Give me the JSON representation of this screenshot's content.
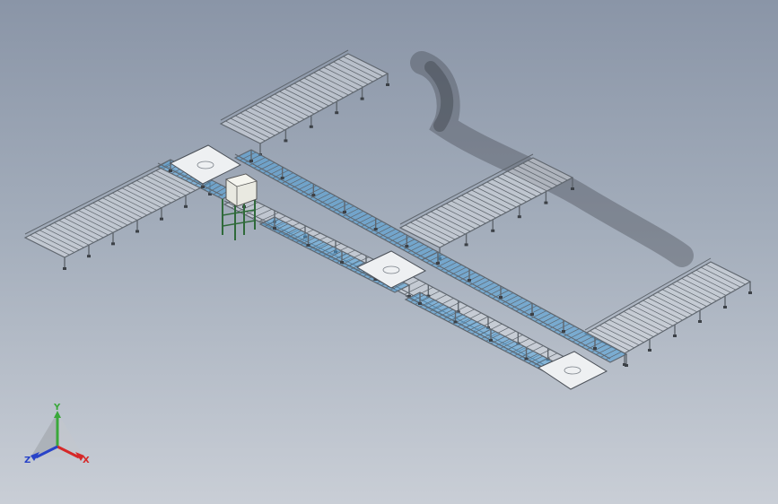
{
  "viewport": {
    "background_top": "#8a95a7",
    "background_bottom": "#c9ced6"
  },
  "model": {
    "frame_color": "#5f666e",
    "roller_color": "#d9dde2",
    "belt_color": "#4a9fd8",
    "stand_color": "#2f6a3a",
    "cabinet_color": "#e9e9e1"
  },
  "triad": {
    "x_label": "X",
    "y_label": "Y",
    "z_label": "Z",
    "x_color": "#d62828",
    "y_color": "#3aa83a",
    "z_color": "#2843c8"
  }
}
